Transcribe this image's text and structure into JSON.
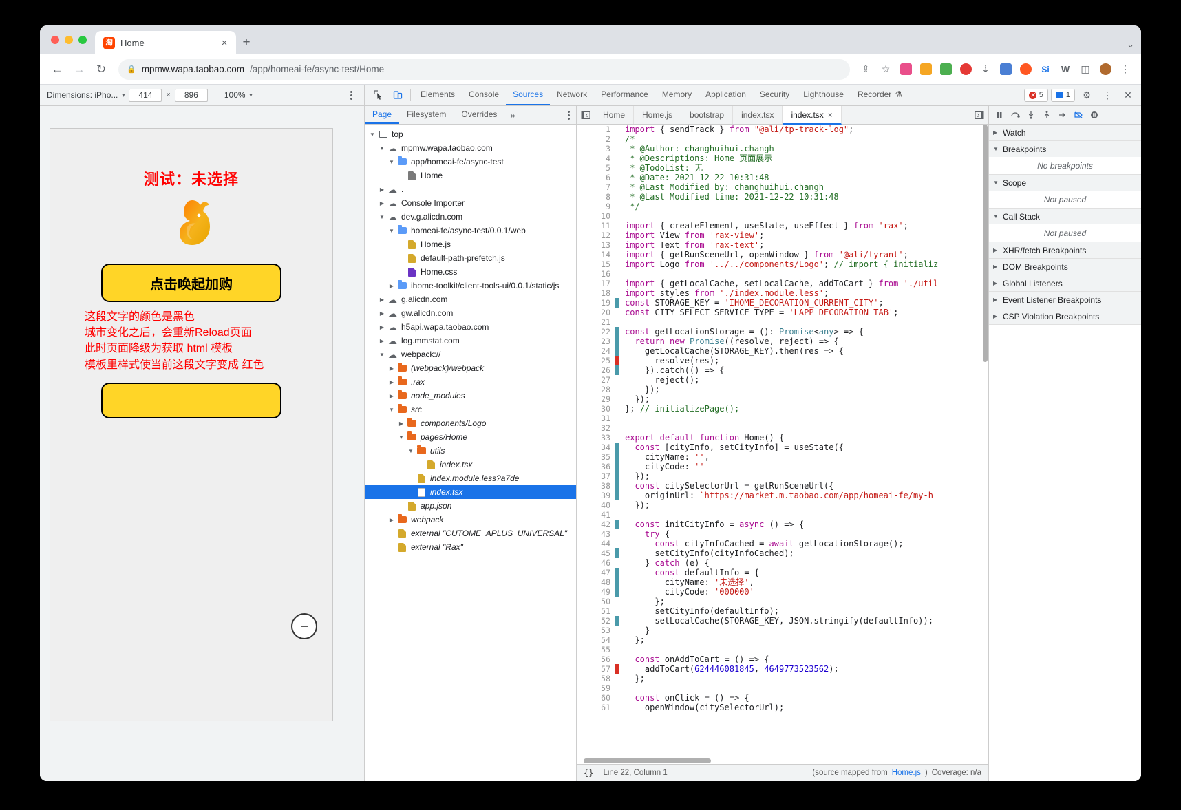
{
  "browser": {
    "tab": {
      "title": "Home",
      "favicon_text": "淘",
      "close_label": "×"
    },
    "new_tab_label": "+",
    "window_menu_label": "⌄",
    "nav": {
      "back": "←",
      "forward": "→",
      "reload": "↻"
    },
    "url": {
      "lock": "🔒",
      "host": "mpmw.wapa.taobao.com",
      "path": "/app/homeai-fe/async-test/Home"
    },
    "omni_icons": [
      "share-icon",
      "bookmark-star-icon",
      "extension-pink-icon",
      "extension-orange-icon",
      "extension-green-icon",
      "extension-red-icon",
      "download-icon",
      "extension-blue-icon",
      "extension-circle-icon",
      "si-icon",
      "w-icon",
      "sidepanel-icon",
      "profile-icon",
      "kebab-menu-icon"
    ]
  },
  "device_toolbar": {
    "dimensions_label": "Dimensions: iPho...",
    "width": "414",
    "height": "896",
    "times": "×",
    "zoom": "100%",
    "caret": "▾"
  },
  "devtools": {
    "inspect_icon": "inspect-element-icon",
    "device_icon": "toggle-device-toolbar-icon",
    "tabs": [
      {
        "label": "Elements",
        "active": false
      },
      {
        "label": "Console",
        "active": false
      },
      {
        "label": "Sources",
        "active": true
      },
      {
        "label": "Network",
        "active": false
      },
      {
        "label": "Performance",
        "active": false
      },
      {
        "label": "Memory",
        "active": false
      },
      {
        "label": "Application",
        "active": false
      },
      {
        "label": "Security",
        "active": false
      },
      {
        "label": "Lighthouse",
        "active": false
      },
      {
        "label": "Recorder",
        "active": false
      }
    ],
    "recorder_flask": "⚗",
    "error_count": "5",
    "message_count": "1",
    "settings_icon": "gear-icon",
    "more_icon": "kebab-menu-icon",
    "close_icon": "close-icon"
  },
  "preview": {
    "title": "测试：未选择",
    "logo": "rax-rabbit-logo",
    "button_primary": "点击唤起加购",
    "red_lines": [
      "这段文字的颜色是黑色",
      "城市变化之后，会重新Reload页面",
      "此时页面降级为获取 html 模板",
      "模板里样式使当前这段文字变成 红色"
    ],
    "float_button": "collapse-icon"
  },
  "navigator": {
    "tabs": [
      {
        "label": "Page",
        "active": true
      },
      {
        "label": "Filesystem",
        "active": false
      },
      {
        "label": "Overrides",
        "active": false
      }
    ],
    "more": "»",
    "tree": [
      {
        "indent": 0,
        "twisty": "▼",
        "icon": "frame",
        "label": "top",
        "italic": false,
        "selected": false
      },
      {
        "indent": 1,
        "twisty": "▼",
        "icon": "cloud",
        "label": "mpmw.wapa.taobao.com",
        "italic": false,
        "selected": false
      },
      {
        "indent": 2,
        "twisty": "▼",
        "icon": "folder-blue",
        "label": "app/homeai-fe/async-test",
        "italic": false,
        "selected": false
      },
      {
        "indent": 3,
        "twisty": "",
        "icon": "file-gray",
        "label": "Home",
        "italic": false,
        "selected": false
      },
      {
        "indent": 1,
        "twisty": "▶",
        "icon": "cloud",
        "label": ".",
        "italic": false,
        "selected": false
      },
      {
        "indent": 1,
        "twisty": "▶",
        "icon": "cloud",
        "label": "Console Importer",
        "italic": false,
        "selected": false
      },
      {
        "indent": 1,
        "twisty": "▼",
        "icon": "cloud",
        "label": "dev.g.alicdn.com",
        "italic": false,
        "selected": false
      },
      {
        "indent": 2,
        "twisty": "▼",
        "icon": "folder-blue",
        "label": "homeai-fe/async-test/0.0.1/web",
        "italic": false,
        "selected": false
      },
      {
        "indent": 3,
        "twisty": "",
        "icon": "file-yellow",
        "label": "Home.js",
        "italic": false,
        "selected": false
      },
      {
        "indent": 3,
        "twisty": "",
        "icon": "file-yellow",
        "label": "default-path-prefetch.js",
        "italic": false,
        "selected": false
      },
      {
        "indent": 3,
        "twisty": "",
        "icon": "file-purple",
        "label": "Home.css",
        "italic": false,
        "selected": false
      },
      {
        "indent": 2,
        "twisty": "▶",
        "icon": "folder-blue",
        "label": "ihome-toolkit/client-tools-ui/0.0.1/static/js",
        "italic": false,
        "selected": false
      },
      {
        "indent": 1,
        "twisty": "▶",
        "icon": "cloud",
        "label": "g.alicdn.com",
        "italic": false,
        "selected": false
      },
      {
        "indent": 1,
        "twisty": "▶",
        "icon": "cloud",
        "label": "gw.alicdn.com",
        "italic": false,
        "selected": false
      },
      {
        "indent": 1,
        "twisty": "▶",
        "icon": "cloud",
        "label": "h5api.wapa.taobao.com",
        "italic": false,
        "selected": false
      },
      {
        "indent": 1,
        "twisty": "▶",
        "icon": "cloud",
        "label": "log.mmstat.com",
        "italic": false,
        "selected": false
      },
      {
        "indent": 1,
        "twisty": "▼",
        "icon": "cloud",
        "label": "webpack://",
        "italic": false,
        "selected": false
      },
      {
        "indent": 2,
        "twisty": "▶",
        "icon": "folder-orange",
        "label": "(webpack)/webpack",
        "italic": true,
        "selected": false
      },
      {
        "indent": 2,
        "twisty": "▶",
        "icon": "folder-orange",
        "label": ".rax",
        "italic": true,
        "selected": false
      },
      {
        "indent": 2,
        "twisty": "▶",
        "icon": "folder-orange",
        "label": "node_modules",
        "italic": true,
        "selected": false
      },
      {
        "indent": 2,
        "twisty": "▼",
        "icon": "folder-orange",
        "label": "src",
        "italic": true,
        "selected": false
      },
      {
        "indent": 3,
        "twisty": "▶",
        "icon": "folder-orange",
        "label": "components/Logo",
        "italic": true,
        "selected": false
      },
      {
        "indent": 3,
        "twisty": "▼",
        "icon": "folder-orange",
        "label": "pages/Home",
        "italic": true,
        "selected": false
      },
      {
        "indent": 4,
        "twisty": "▼",
        "icon": "folder-orange",
        "label": "utils",
        "italic": true,
        "selected": false
      },
      {
        "indent": 5,
        "twisty": "",
        "icon": "file-yellow",
        "label": "index.tsx",
        "italic": true,
        "selected": false
      },
      {
        "indent": 4,
        "twisty": "",
        "icon": "file-yellow",
        "label": "index.module.less?a7de",
        "italic": true,
        "selected": false
      },
      {
        "indent": 4,
        "twisty": "",
        "icon": "file-white",
        "label": "index.tsx",
        "italic": true,
        "selected": true
      },
      {
        "indent": 3,
        "twisty": "",
        "icon": "file-yellow",
        "label": "app.json",
        "italic": true,
        "selected": false
      },
      {
        "indent": 2,
        "twisty": "▶",
        "icon": "folder-orange",
        "label": "webpack",
        "italic": true,
        "selected": false
      },
      {
        "indent": 2,
        "twisty": "",
        "icon": "file-yellow",
        "label": "external \"CUTOME_APLUS_UNIVERSAL\"",
        "italic": true,
        "selected": false
      },
      {
        "indent": 2,
        "twisty": "",
        "icon": "file-yellow",
        "label": "external \"Rax\"",
        "italic": true,
        "selected": false
      }
    ]
  },
  "editor": {
    "tabs": [
      {
        "label": "Home",
        "active": false,
        "closeable": false
      },
      {
        "label": "Home.js",
        "active": false,
        "closeable": false
      },
      {
        "label": "bootstrap",
        "active": false,
        "closeable": false
      },
      {
        "label": "index.tsx",
        "active": false,
        "closeable": false
      },
      {
        "label": "index.tsx",
        "active": true,
        "closeable": true
      }
    ],
    "close_glyph": "×",
    "prev_icon": "show-navigator-icon",
    "next_icon": "show-debugger-icon",
    "lines": [
      {
        "n": 1,
        "cov": "",
        "html": "<span class='k-purple'>import</span> { sendTrack } <span class='k-purple'>from</span> <span class='str'>\"@ali/tp-track-log\"</span>;"
      },
      {
        "n": 2,
        "cov": "",
        "html": "<span class='cmt'>/*</span>"
      },
      {
        "n": 3,
        "cov": "",
        "html": "<span class='cmt'> * @Author: changhuihui.changh</span>"
      },
      {
        "n": 4,
        "cov": "",
        "html": "<span class='cmt'> * @Descriptions: Home 页面展示</span>"
      },
      {
        "n": 5,
        "cov": "",
        "html": "<span class='cmt'> * @TodoList: 无</span>"
      },
      {
        "n": 6,
        "cov": "",
        "html": "<span class='cmt'> * @Date: 2021-12-22 10:31:48</span>"
      },
      {
        "n": 7,
        "cov": "",
        "html": "<span class='cmt'> * @Last Modified by: changhuihui.changh</span>"
      },
      {
        "n": 8,
        "cov": "",
        "html": "<span class='cmt'> * @Last Modified time: 2021-12-22 10:31:48</span>"
      },
      {
        "n": 9,
        "cov": "",
        "html": "<span class='cmt'> */</span>"
      },
      {
        "n": 10,
        "cov": "",
        "html": ""
      },
      {
        "n": 11,
        "cov": "",
        "html": "<span class='k-purple'>import</span> { createElement, useState, useEffect } <span class='k-purple'>from</span> <span class='str'>'rax'</span>;"
      },
      {
        "n": 12,
        "cov": "",
        "html": "<span class='k-purple'>import</span> View <span class='k-purple'>from</span> <span class='str'>'rax-view'</span>;"
      },
      {
        "n": 13,
        "cov": "",
        "html": "<span class='k-purple'>import</span> Text <span class='k-purple'>from</span> <span class='str'>'rax-text'</span>;"
      },
      {
        "n": 14,
        "cov": "",
        "html": "<span class='k-purple'>import</span> { getRunSceneUrl, openWindow } <span class='k-purple'>from</span> <span class='str'>'@ali/tyrant'</span>;"
      },
      {
        "n": 15,
        "cov": "",
        "html": "<span class='k-purple'>import</span> Logo <span class='k-purple'>from</span> <span class='str'>'../../components/Logo'</span>; <span class='cmt'>// import { initializ</span>"
      },
      {
        "n": 16,
        "cov": "",
        "html": ""
      },
      {
        "n": 17,
        "cov": "",
        "html": "<span class='k-purple'>import</span> { getLocalCache, setLocalCache, addToCart } <span class='k-purple'>from</span> <span class='str'>'./util</span>"
      },
      {
        "n": 18,
        "cov": "",
        "html": "<span class='k-purple'>import</span> styles <span class='k-purple'>from</span> <span class='str'>'./index.module.less'</span>;"
      },
      {
        "n": 19,
        "cov": "teal",
        "html": "<span class='k-purple'>const</span> STORAGE_KEY = <span class='str'>'IHOME_DECORATION_CURRENT_CITY'</span>;"
      },
      {
        "n": 20,
        "cov": "",
        "html": "<span class='k-purple'>const</span> CITY_SELECT_SERVICE_TYPE = <span class='str'>'LAPP_DECORATION_TAB'</span>;"
      },
      {
        "n": 21,
        "cov": "",
        "html": ""
      },
      {
        "n": 22,
        "cov": "teal",
        "html": "<span class='k-purple'>const</span> getLocationStorage = (): <span class='typ'>Promise</span>&lt;<span class='typ'>any</span>&gt; =&gt; {"
      },
      {
        "n": 23,
        "cov": "teal",
        "html": "  <span class='k-purple'>return</span> <span class='k-purple'>new</span> <span class='typ'>Promise</span>((resolve, reject) =&gt; {"
      },
      {
        "n": 24,
        "cov": "teal",
        "html": "    getLocalCache(STORAGE_KEY).then(res =&gt; {"
      },
      {
        "n": 25,
        "cov": "red",
        "html": "      resolve(res);"
      },
      {
        "n": 26,
        "cov": "teal",
        "html": "    }).catch(() =&gt; {"
      },
      {
        "n": 27,
        "cov": "",
        "html": "      reject();"
      },
      {
        "n": 28,
        "cov": "",
        "html": "    });"
      },
      {
        "n": 29,
        "cov": "",
        "html": "  });"
      },
      {
        "n": 30,
        "cov": "",
        "html": "}; <span class='cmt'>// initializePage();</span>"
      },
      {
        "n": 31,
        "cov": "",
        "html": ""
      },
      {
        "n": 32,
        "cov": "",
        "html": ""
      },
      {
        "n": 33,
        "cov": "",
        "html": "<span class='k-purple'>export</span> <span class='k-purple'>default</span> <span class='k-purple'>function</span> Home() {"
      },
      {
        "n": 34,
        "cov": "teal",
        "html": "  <span class='k-purple'>const</span> [cityInfo, setCityInfo] = useState({"
      },
      {
        "n": 35,
        "cov": "teal",
        "html": "    cityName: <span class='str'>''</span>,"
      },
      {
        "n": 36,
        "cov": "teal",
        "html": "    cityCode: <span class='str'>''</span>"
      },
      {
        "n": 37,
        "cov": "teal",
        "html": "  });"
      },
      {
        "n": 38,
        "cov": "teal",
        "html": "  <span class='k-purple'>const</span> citySelectorUrl = getRunSceneUrl({"
      },
      {
        "n": 39,
        "cov": "teal",
        "html": "    originUrl: <span class='str'>`https://market.m.taobao.com/app/homeai-fe/my-h</span>"
      },
      {
        "n": 40,
        "cov": "",
        "html": "  });"
      },
      {
        "n": 41,
        "cov": "",
        "html": ""
      },
      {
        "n": 42,
        "cov": "teal",
        "html": "  <span class='k-purple'>const</span> initCityInfo = <span class='k-purple'>async</span> () =&gt; {"
      },
      {
        "n": 43,
        "cov": "",
        "html": "    <span class='k-purple'>try</span> {"
      },
      {
        "n": 44,
        "cov": "",
        "html": "      <span class='k-purple'>const</span> cityInfoCached = <span class='k-purple'>await</span> getLocationStorage();"
      },
      {
        "n": 45,
        "cov": "teal",
        "html": "      setCityInfo(cityInfoCached);"
      },
      {
        "n": 46,
        "cov": "",
        "html": "    } <span class='k-purple'>catch</span> (e) {"
      },
      {
        "n": 47,
        "cov": "teal",
        "html": "      <span class='k-purple'>const</span> defaultInfo = {"
      },
      {
        "n": 48,
        "cov": "teal",
        "html": "        cityName: <span class='cjk'>'未选择'</span>,"
      },
      {
        "n": 49,
        "cov": "teal",
        "html": "        cityCode: <span class='str'>'000000'</span>"
      },
      {
        "n": 50,
        "cov": "",
        "html": "      };"
      },
      {
        "n": 51,
        "cov": "",
        "html": "      setCityInfo(defaultInfo);"
      },
      {
        "n": 52,
        "cov": "teal",
        "html": "      setLocalCache(STORAGE_KEY, JSON.stringify(defaultInfo));"
      },
      {
        "n": 53,
        "cov": "",
        "html": "    }"
      },
      {
        "n": 54,
        "cov": "",
        "html": "  };"
      },
      {
        "n": 55,
        "cov": "",
        "html": ""
      },
      {
        "n": 56,
        "cov": "",
        "html": "  <span class='k-purple'>const</span> onAddToCart = () =&gt; {"
      },
      {
        "n": 57,
        "cov": "red",
        "html": "    addToCart(<span class='num'>624446081845</span>, <span class='num'>4649773523562</span>);"
      },
      {
        "n": 58,
        "cov": "",
        "html": "  };"
      },
      {
        "n": 59,
        "cov": "",
        "html": ""
      },
      {
        "n": 60,
        "cov": "",
        "html": "  <span class='k-purple'>const</span> onClick = () =&gt; {"
      },
      {
        "n": 61,
        "cov": "",
        "html": "    openWindow(citySelectorUrl);"
      }
    ]
  },
  "statusbar": {
    "braces": "{}",
    "position": "Line 22, Column 1",
    "source_mapped_prefix": "(source mapped from ",
    "source_mapped_link": "Home.js",
    "source_mapped_suffix": ")",
    "coverage": "Coverage: n/a"
  },
  "debugger": {
    "toolbar_icons": [
      "pause-icon",
      "step-over-icon",
      "step-into-icon",
      "step-out-icon",
      "step-icon",
      "deactivate-breakpoints-icon",
      "pause-on-exceptions-icon"
    ],
    "sections": [
      {
        "label": "Watch",
        "expanded": false,
        "empty": ""
      },
      {
        "label": "Breakpoints",
        "expanded": true,
        "empty": "No breakpoints"
      },
      {
        "label": "Scope",
        "expanded": true,
        "empty": "Not paused"
      },
      {
        "label": "Call Stack",
        "expanded": true,
        "empty": "Not paused"
      },
      {
        "label": "XHR/fetch Breakpoints",
        "expanded": false,
        "empty": ""
      },
      {
        "label": "DOM Breakpoints",
        "expanded": false,
        "empty": ""
      },
      {
        "label": "Global Listeners",
        "expanded": false,
        "empty": ""
      },
      {
        "label": "Event Listener Breakpoints",
        "expanded": false,
        "empty": ""
      },
      {
        "label": "CSP Violation Breakpoints",
        "expanded": false,
        "empty": ""
      }
    ]
  }
}
